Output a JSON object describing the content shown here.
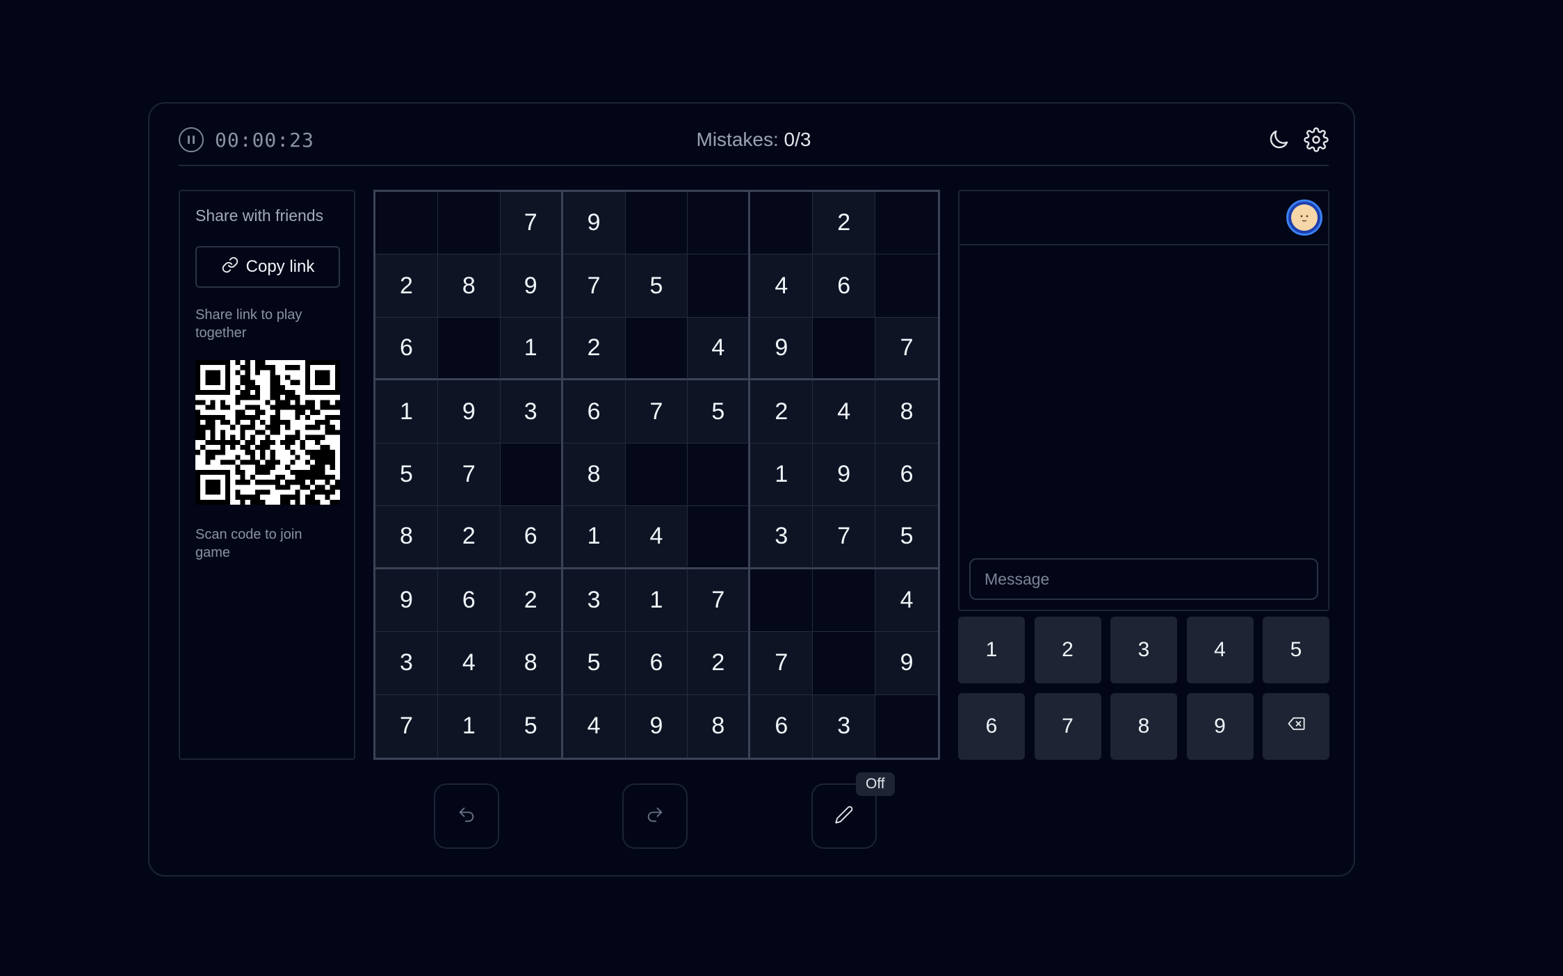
{
  "header": {
    "timer": "00:00:23",
    "mistakes_label": "Mistakes:",
    "mistakes_value": "0/3"
  },
  "share": {
    "title": "Share with friends",
    "copy_label": "Copy link",
    "link_note": "Share link to play together",
    "scan_note": "Scan code to join game"
  },
  "board": [
    [
      "",
      "",
      "7",
      "9",
      "",
      "",
      "",
      "2",
      ""
    ],
    [
      "2",
      "8",
      "9",
      "7",
      "5",
      "",
      "4",
      "6",
      ""
    ],
    [
      "6",
      "",
      "1",
      "2",
      "",
      "4",
      "9",
      "",
      "7"
    ],
    [
      "1",
      "9",
      "3",
      "6",
      "7",
      "5",
      "2",
      "4",
      "8"
    ],
    [
      "5",
      "7",
      "",
      "8",
      "",
      "",
      "1",
      "9",
      "6"
    ],
    [
      "8",
      "2",
      "6",
      "1",
      "4",
      "",
      "3",
      "7",
      "5"
    ],
    [
      "9",
      "6",
      "2",
      "3",
      "1",
      "7",
      "",
      "",
      "4"
    ],
    [
      "3",
      "4",
      "8",
      "5",
      "6",
      "2",
      "7",
      "",
      "9"
    ],
    [
      "7",
      "1",
      "5",
      "4",
      "9",
      "8",
      "6",
      "3",
      ""
    ]
  ],
  "chat": {
    "placeholder": "Message"
  },
  "numpad": [
    "1",
    "2",
    "3",
    "4",
    "5",
    "6",
    "7",
    "8",
    "9"
  ],
  "notes": {
    "state": "Off"
  },
  "icons": {
    "pause": "pause-icon",
    "theme": "moon-icon",
    "settings": "gear-icon",
    "copy": "link-icon",
    "backspace": "backspace-icon",
    "undo": "undo-icon",
    "redo": "redo-icon",
    "notes": "pencil-icon"
  },
  "colors": {
    "background": "#030617",
    "cell": "#0e1424",
    "key": "#1e2433",
    "avatar_ring": "#3b82f6"
  }
}
